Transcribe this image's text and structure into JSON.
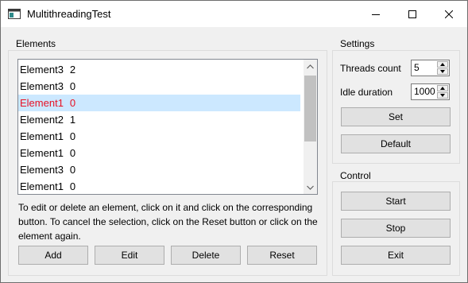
{
  "window": {
    "title": "MultithreadingTest"
  },
  "elements_group": {
    "title": "Elements",
    "items": [
      {
        "name": "Element3",
        "value": "2"
      },
      {
        "name": "Element3",
        "value": "0"
      },
      {
        "name": "Element1",
        "value": "0",
        "selected": true
      },
      {
        "name": "Element2",
        "value": "1"
      },
      {
        "name": "Element1",
        "value": "0"
      },
      {
        "name": "Element1",
        "value": "0"
      },
      {
        "name": "Element3",
        "value": "0"
      },
      {
        "name": "Element1",
        "value": "0"
      }
    ],
    "hint": "To edit or delete an element, click on it and click on the corresponding button. To cancel the selection, click on the Reset button or click on the element again.",
    "buttons": {
      "add": "Add",
      "edit": "Edit",
      "delete": "Delete",
      "reset": "Reset"
    }
  },
  "settings_group": {
    "title": "Settings",
    "threads_label": "Threads count",
    "threads_value": "5",
    "idle_label": "Idle duration",
    "idle_value": "1000",
    "set_button": "Set",
    "default_button": "Default"
  },
  "control_group": {
    "title": "Control",
    "start_button": "Start",
    "stop_button": "Stop",
    "exit_button": "Exit"
  },
  "colors": {
    "selection_bg": "#cce8ff",
    "selection_text": "#e81123",
    "button_bg": "#e1e1e1"
  }
}
